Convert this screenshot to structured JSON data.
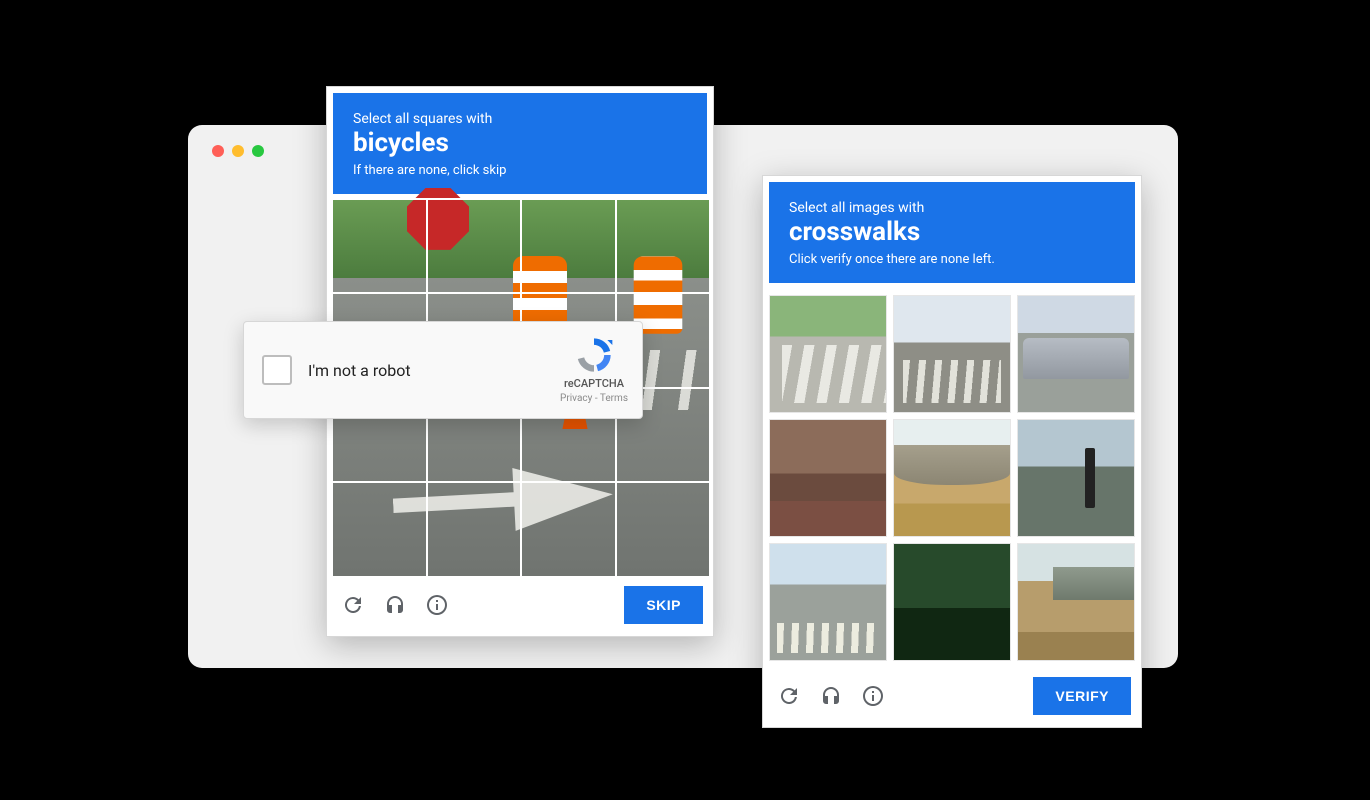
{
  "captcha_left": {
    "line1": "Select all squares with",
    "target": "bicycles",
    "line3": "If there are none, click skip",
    "grid_rows": 4,
    "grid_cols": 4,
    "action_label": "SKIP"
  },
  "captcha_right": {
    "line1": "Select all images with",
    "target": "crosswalks",
    "line3": "Click verify once there are none left.",
    "grid_rows": 3,
    "grid_cols": 3,
    "tiles": [
      "street-crosswalk",
      "intersection-crosswalk",
      "minivan-street",
      "house-roof",
      "highway-overpass",
      "traffic-light-road",
      "downtown-street-crosswalk",
      "trees-dark",
      "hillside-overpass"
    ],
    "action_label": "VERIFY"
  },
  "recaptcha_widget": {
    "label": "I'm not a robot",
    "brand": "reCAPTCHA",
    "legal": "Privacy - Terms"
  },
  "colors": {
    "accent": "#1a73e8"
  }
}
